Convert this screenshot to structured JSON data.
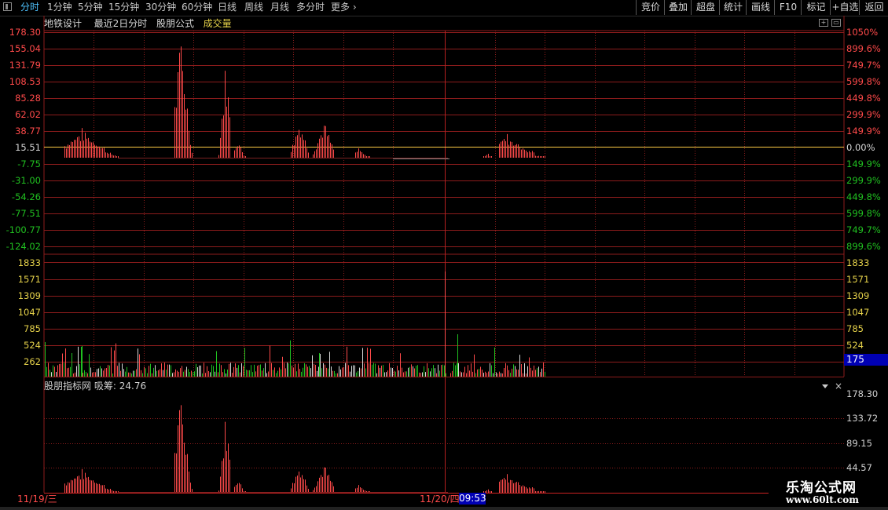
{
  "toolbar": {
    "tabs": [
      {
        "label": "分时",
        "active": true
      },
      {
        "label": "1分钟"
      },
      {
        "label": "5分钟"
      },
      {
        "label": "15分钟"
      },
      {
        "label": "30分钟"
      },
      {
        "label": "60分钟"
      },
      {
        "label": "日线"
      },
      {
        "label": "周线"
      },
      {
        "label": "月线"
      },
      {
        "label": "多分时"
      },
      {
        "label": "更多"
      }
    ],
    "right_buttons": [
      "竞价",
      "叠加",
      "超盘",
      "统计",
      "画线",
      "F10",
      "标记",
      "+自选",
      "返回"
    ]
  },
  "info": {
    "stock_name": "地铁设计",
    "period": "最近2日分时",
    "formula": "股朋公式",
    "volume_label": "成交量"
  },
  "price_axis": {
    "left": [
      "178.30",
      "155.04",
      "131.79",
      "108.53",
      "85.28",
      "62.02",
      "38.77",
      "15.51",
      "-7.75",
      "-31.00",
      "-54.26",
      "-77.51",
      "-100.77",
      "-124.02"
    ],
    "right": [
      "1050%",
      "899.6%",
      "749.7%",
      "599.8%",
      "449.8%",
      "299.9%",
      "149.9%",
      "0.00%",
      "149.9%",
      "299.9%",
      "449.8%",
      "599.8%",
      "749.7%",
      "899.6%"
    ],
    "base_value": "15.51"
  },
  "volume_axis": {
    "labels": [
      "1833",
      "1571",
      "1309",
      "1047",
      "785",
      "524",
      "262"
    ],
    "current_badge": "175"
  },
  "indicator": {
    "title": "股朋指标网",
    "name": "吸筹",
    "value": "24.76",
    "axis": [
      "178.30",
      "133.72",
      "89.15",
      "44.57"
    ]
  },
  "dates": {
    "day1": "11/19/三",
    "day2": "11/20/四",
    "time": "09:53"
  },
  "watermark": {
    "title": "乐淘公式网",
    "url": "www.60lt.com"
  },
  "icons": {
    "panel": "panel-toggle-icon",
    "more": "chevron-right-icon",
    "zoom_in": "zoom-in-icon",
    "restore": "window-restore-icon",
    "dropdown": "dropdown-triangle-icon",
    "close": "close-icon"
  },
  "colors": {
    "background": "#000000",
    "grid": "#8c1c1c",
    "up": "#ff4a4a",
    "down": "#20c020",
    "baseline": "#ffcc44",
    "active_tab": "#4fc3ff",
    "badge": "#0000b4"
  }
}
